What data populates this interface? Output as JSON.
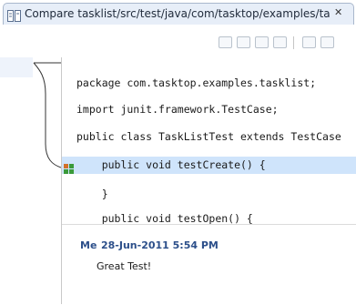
{
  "tab": {
    "title": "Compare tasklist/src/test/java/com/tasktop/examples/ta",
    "close_symbol": "✕",
    "icon": "compare-icon"
  },
  "toolbar": {
    "icons": [
      "copy-left-icon",
      "copy-right-icon",
      "next-difference-icon",
      "previous-difference-icon",
      "next-change-icon",
      "previous-change-icon"
    ]
  },
  "editor": {
    "lines": [
      "package com.tasktop.examples.tasklist;",
      "import junit.framework.TestCase;",
      "public class TaskListTest extends TestCase",
      "    public void testCreate() {",
      "    }",
      "    public void testOpen() {"
    ],
    "highlight_color": "#cfe4fb",
    "marker_icon": "review-comment-icon"
  },
  "comment": {
    "author": "Me",
    "date": "28-Jun-2011 5:54 PM",
    "body": "Great Test!"
  }
}
